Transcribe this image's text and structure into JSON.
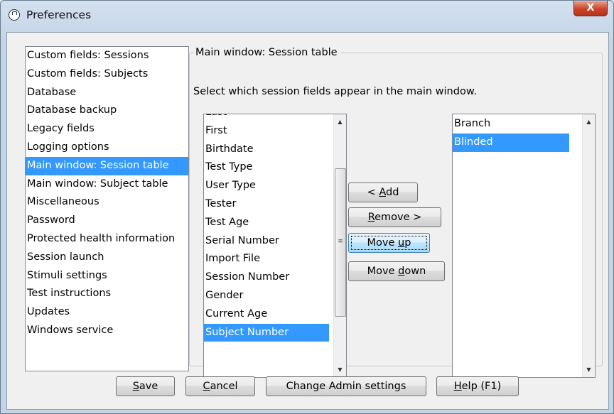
{
  "window": {
    "title": "Preferences",
    "close_label": "X"
  },
  "categories": [
    {
      "label": "Custom fields: Sessions"
    },
    {
      "label": "Custom fields: Subjects"
    },
    {
      "label": "Database"
    },
    {
      "label": "Database backup"
    },
    {
      "label": "Legacy fields"
    },
    {
      "label": "Logging options"
    },
    {
      "label": "Main window: Session table",
      "selected": true
    },
    {
      "label": "Main window: Subject table"
    },
    {
      "label": "Miscellaneous"
    },
    {
      "label": "Password"
    },
    {
      "label": "Protected health information"
    },
    {
      "label": "Session launch"
    },
    {
      "label": "Stimuli settings"
    },
    {
      "label": "Test instructions"
    },
    {
      "label": "Updates"
    },
    {
      "label": "Windows service"
    }
  ],
  "panel": {
    "title": "Main window: Session table",
    "instructions": "Select which session fields appear in the main window."
  },
  "available_fields": [
    {
      "label": "Last"
    },
    {
      "label": "First"
    },
    {
      "label": "Birthdate"
    },
    {
      "label": "Test Type"
    },
    {
      "label": "User Type"
    },
    {
      "label": "Tester"
    },
    {
      "label": "Test Age"
    },
    {
      "label": "Serial Number"
    },
    {
      "label": "Import File"
    },
    {
      "label": "Session Number"
    },
    {
      "label": "Gender"
    },
    {
      "label": "Current Age"
    },
    {
      "label": "Subject Number",
      "selected": true
    }
  ],
  "selected_fields": [
    {
      "label": "Branch"
    },
    {
      "label": "Blinded",
      "selected": true
    }
  ],
  "actions": {
    "add": {
      "label": "< Add",
      "mnemonic": "A"
    },
    "remove": {
      "label": "Remove >",
      "mnemonic": "R"
    },
    "move_up": {
      "label": "Move up",
      "mnemonic": "u"
    },
    "move_down": {
      "label": "Move down",
      "mnemonic": "d"
    }
  },
  "footer": {
    "save": {
      "label": "Save",
      "mnemonic": "S"
    },
    "cancel": {
      "label": "Cancel",
      "mnemonic": "C"
    },
    "change_admin": {
      "label": "Change Admin settings"
    },
    "help": {
      "label": "Help (F1)",
      "mnemonic": "H"
    }
  },
  "colors": {
    "selection": "#3399ff",
    "close_button": "#c9462a",
    "window_frame": "#c4d4e7"
  },
  "icons": {
    "app": "app-icon",
    "close": "close-icon",
    "scroll_up": "scroll-up-arrow-icon",
    "scroll_down": "scroll-down-arrow-icon",
    "grip": "scroll-grip-icon"
  }
}
